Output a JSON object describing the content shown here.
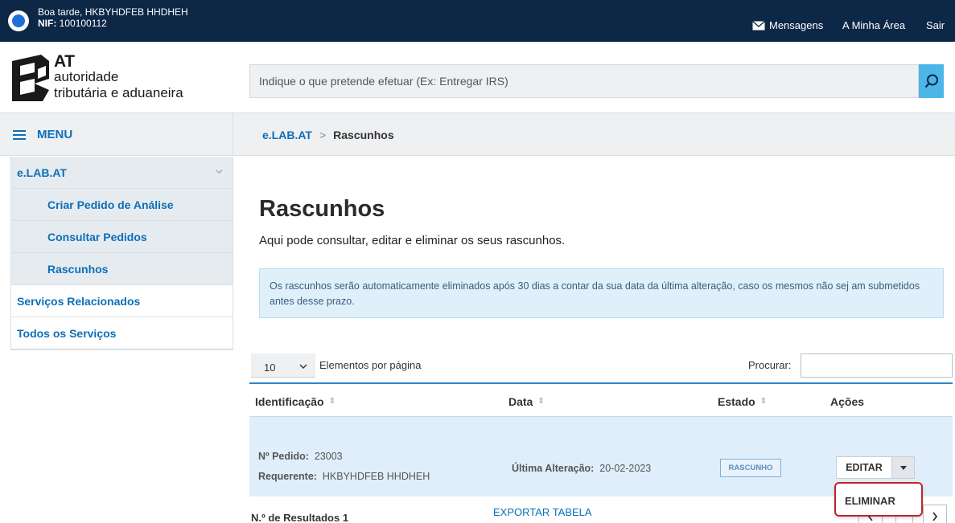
{
  "topbar": {
    "greeting": "Boa tarde, HKBYHDFEB HHDHEH",
    "nif_label": "NIF:",
    "nif_value": "100100112",
    "messages": "Mensagens",
    "my_area": "A Minha Área",
    "logout": "Sair"
  },
  "logo": {
    "line1": "AT",
    "line2": "autoridade",
    "line3": "tributária e aduaneira"
  },
  "search": {
    "placeholder": "Indique o que pretende efetuar (Ex: Entregar IRS)"
  },
  "menu": {
    "label": "MENU"
  },
  "breadcrumb": {
    "parent": "e.LAB.AT",
    "separator": ">",
    "current": "Rascunhos"
  },
  "sidebar": {
    "group": "e.LAB.AT",
    "subitems": [
      "Criar Pedido de Análise",
      "Consultar Pedidos",
      "Rascunhos"
    ],
    "items": [
      "Serviços Relacionados",
      "Todos os Serviços"
    ]
  },
  "page": {
    "title": "Rascunhos",
    "description": "Aqui pode consultar, editar e eliminar os seus rascunhos.",
    "info": "Os rascunhos serão automaticamente eliminados após 30 dias a contar da sua data da última alteração, caso os mesmos não sej am submetidos antes desse prazo."
  },
  "table_controls": {
    "page_size": "10",
    "page_size_label": "Elementos por página",
    "search_label": "Procurar:"
  },
  "table": {
    "headers": [
      "Identificação",
      "Data",
      "Estado",
      "Ações"
    ],
    "rows": [
      {
        "order_label": "Nº Pedido:",
        "order_value": "23003",
        "requester_label": "Requerente:",
        "requester_value": "HKBYHDFEB HHDHEH",
        "date_label": "Última Alteração:",
        "date_value": "20-02-2023",
        "status": "RASCUNHO",
        "edit": "EDITAR"
      }
    ],
    "dropdown_item": "ELIMINAR"
  },
  "footer": {
    "results_label": "N.º de Resultados 1",
    "export": "EXPORTAR TABELA"
  },
  "colors": {
    "topbar": "#0d2747",
    "link": "#0b6fb8",
    "accent": "#4cb6e8",
    "highlight_border": "#c0242c"
  }
}
